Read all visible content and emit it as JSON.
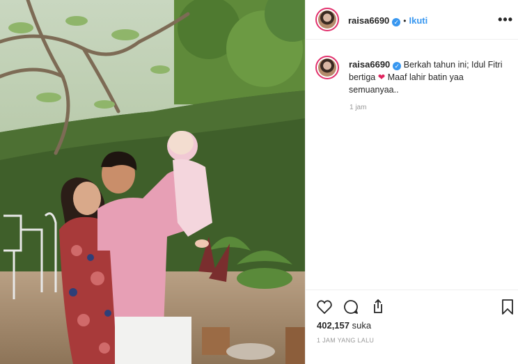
{
  "header": {
    "username": "raisa6690",
    "verified_mark": "✓",
    "separator": "•",
    "follow_label": "Ikuti",
    "more_label": "•••"
  },
  "caption": {
    "username": "raisa6690",
    "text_before": "Berkah tahun ini; Idul Fitri bertiga",
    "emoji": "❤",
    "text_after": "Maaf lahir batin yaa semuanyaa..",
    "time": "1 jam"
  },
  "actions": {
    "likes_count": "402,157",
    "likes_label": "suka",
    "timestamp": "1 JAM YANG LALU",
    "icons": [
      "heart-icon",
      "comment-icon",
      "share-icon",
      "bookmark-icon"
    ]
  },
  "colors": {
    "accent_blue": "#3897f0",
    "story_ring": "#e1306c",
    "heart_red": "#e0245e",
    "text": "#262626",
    "muted": "#999999"
  }
}
